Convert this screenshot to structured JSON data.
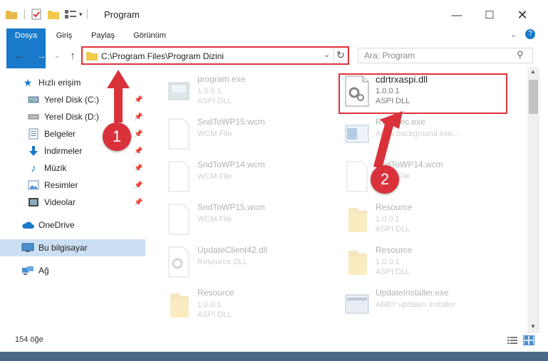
{
  "window": {
    "title": "Program"
  },
  "ribbon": {
    "tabs": [
      "Dosya",
      "Giriş",
      "Paylaş",
      "Görünüm"
    ]
  },
  "nav": {
    "path": "C:\\Program Files\\Program Dizini",
    "search_placeholder": "Ara: Program"
  },
  "sidebar": {
    "quick_access": "Hızlı erişim",
    "items": [
      {
        "label": "Yerel Disk (C:)",
        "icon": "drive-icon"
      },
      {
        "label": "Yerel Disk (D:)",
        "icon": "drive-icon"
      },
      {
        "label": "Belgeler",
        "icon": "documents-icon"
      },
      {
        "label": "İndirmeler",
        "icon": "download-icon"
      },
      {
        "label": "Müzik",
        "icon": "music-icon"
      },
      {
        "label": "Resimler",
        "icon": "pictures-icon"
      },
      {
        "label": "Videolar",
        "icon": "videos-icon"
      }
    ],
    "onedrive": "OneDrive",
    "this_pc": "Bu bilgisayar",
    "network": "Ağ"
  },
  "files": [
    {
      "name": "program.exe",
      "sub": "1.0.0.1",
      "sub2": "ASPI DLL",
      "icon": "exe-icon"
    },
    {
      "name": "cdrtrxaspi.dll",
      "sub": "1.0.0.1",
      "sub2": "ASPI DLL",
      "icon": "dll-gear-icon"
    },
    {
      "name": "SndToWP15.wcm",
      "sub": "WCM File",
      "sub2": "",
      "icon": "blank-file-icon"
    },
    {
      "name": "RWSpec.exe",
      "sub": "Allow background exe...",
      "sub2": "",
      "icon": "exe-icon"
    },
    {
      "name": "SndToWP14.wcm",
      "sub": "WCM File",
      "sub2": "",
      "icon": "blank-file-icon"
    },
    {
      "name": "SndToWP14.wcm",
      "sub": "WCM File",
      "sub2": "",
      "icon": "blank-file-icon"
    },
    {
      "name": "SndToWP15.wcm",
      "sub": "WCM File",
      "sub2": "",
      "icon": "blank-file-icon"
    },
    {
      "name": "Resource",
      "sub": "1.0.0.1",
      "sub2": "ASPI DLL",
      "icon": "folder-icon"
    },
    {
      "name": "UpdateClient42.dll",
      "sub": "Resource DLL",
      "sub2": "",
      "icon": "dll-gear-icon"
    },
    {
      "name": "Resource",
      "sub": "1.0.0.1",
      "sub2": "ASPI DLL",
      "icon": "folder-icon"
    },
    {
      "name": "Resource",
      "sub": "1.0.0.1",
      "sub2": "ASPI DLL",
      "icon": "folder-icon"
    },
    {
      "name": "UpdateInstaller.exe",
      "sub": "ABBY updates installer",
      "sub2": "",
      "icon": "exe-icon"
    }
  ],
  "status": {
    "count": "154 öğe"
  },
  "annotations": {
    "step1": "1",
    "step2": "2"
  },
  "colors": {
    "accent": "#1979ca",
    "highlight": "#e0333a",
    "badge": "#d9323b"
  }
}
